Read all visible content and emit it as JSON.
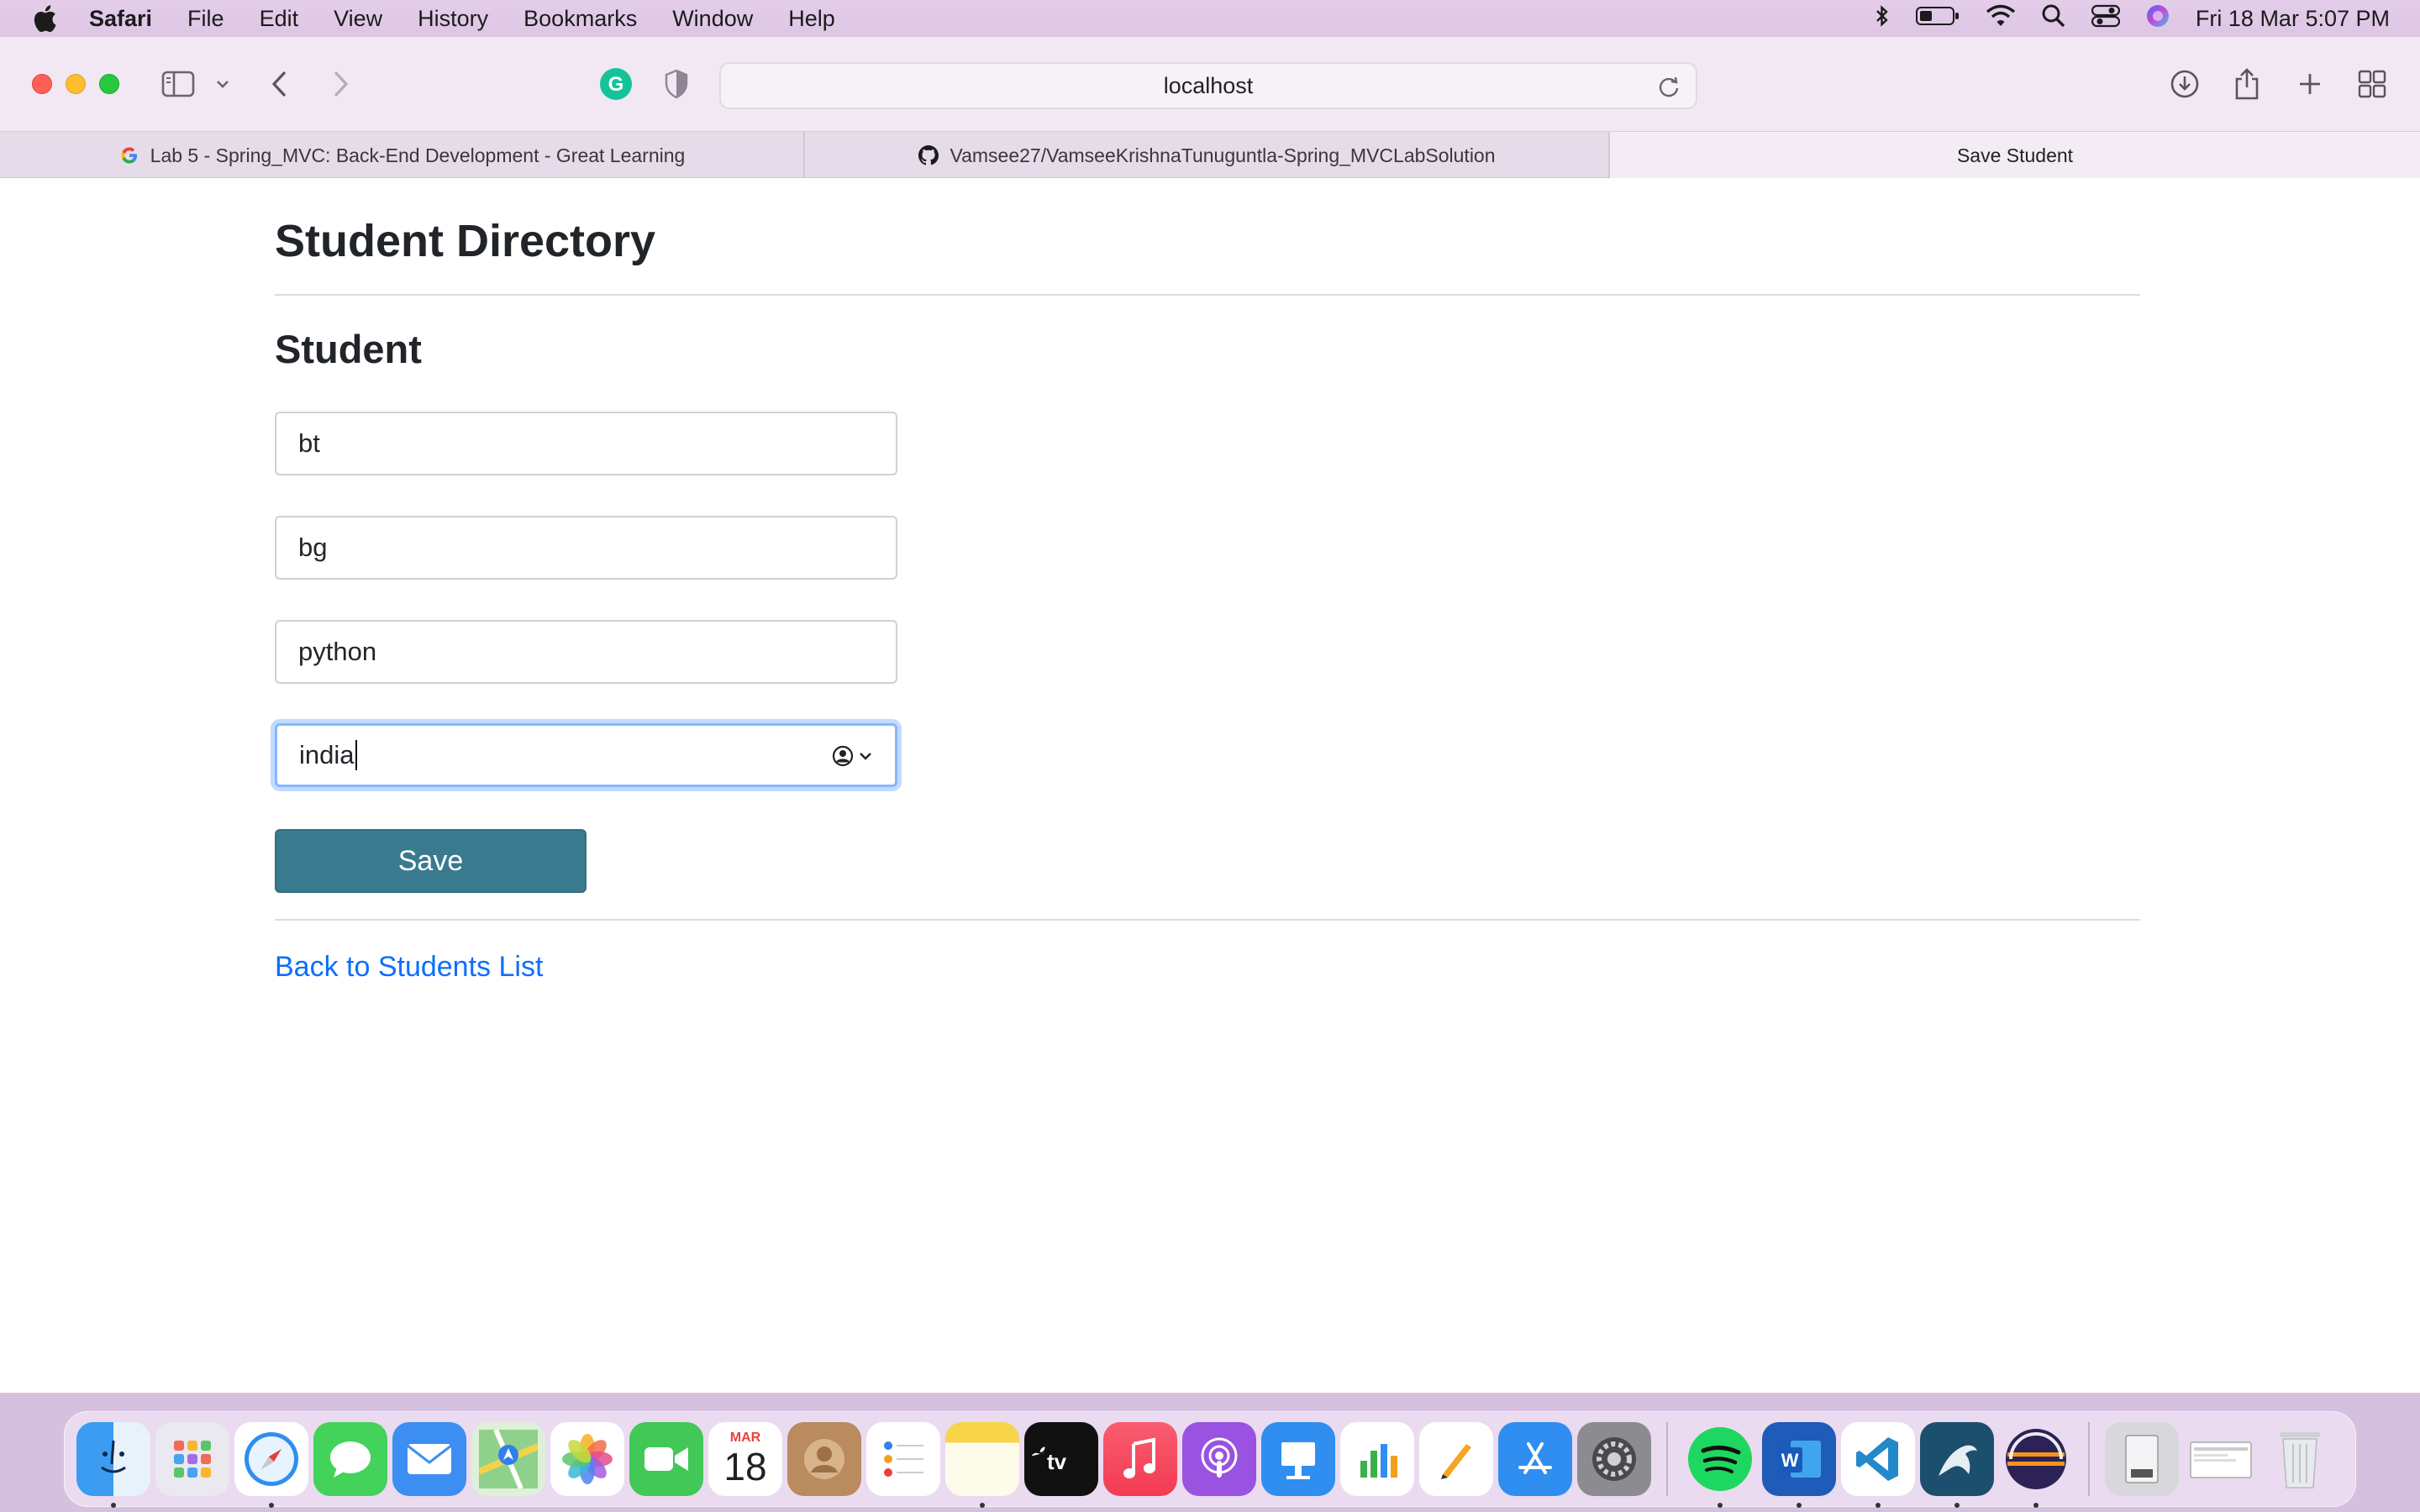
{
  "menubar": {
    "app_name": "Safari",
    "items": [
      "File",
      "Edit",
      "View",
      "History",
      "Bookmarks",
      "Window",
      "Help"
    ],
    "clock": "Fri 18 Mar  5:07 PM"
  },
  "browser": {
    "address": "localhost",
    "tabs": [
      {
        "label": "Lab 5 - Spring_MVC: Back-End Development - Great Learning",
        "icon": "google-icon"
      },
      {
        "label": "Vamsee27/VamseeKrishnaTunuguntla-Spring_MVCLabSolution",
        "icon": "github-icon"
      },
      {
        "label": "Save Student",
        "icon": ""
      }
    ]
  },
  "page": {
    "title": "Student Directory",
    "subtitle": "Student",
    "fields": [
      "bt",
      "bg",
      "python",
      "india"
    ],
    "save_label": "Save",
    "back_link": "Back to Students List"
  },
  "dock": {
    "calendar_month": "MAR",
    "calendar_day": "18"
  },
  "colors": {
    "button": "#3a7a8e",
    "link": "#0d6efd",
    "focus_ring": "#86b7fe"
  }
}
